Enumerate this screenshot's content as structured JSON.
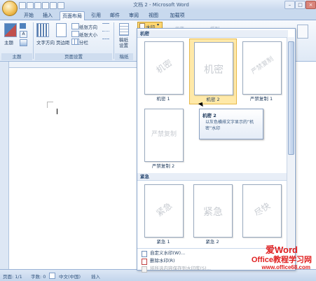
{
  "window": {
    "title": "文档 2 - Microsoft Word",
    "controls": {
      "minimize": "–",
      "maximize": "□",
      "close": "×"
    }
  },
  "tabs": [
    {
      "label": "开始"
    },
    {
      "label": "插入"
    },
    {
      "label": "页面布局",
      "active": true
    },
    {
      "label": "引用"
    },
    {
      "label": "邮件"
    },
    {
      "label": "审阅"
    },
    {
      "label": "视图"
    },
    {
      "label": "加载项"
    }
  ],
  "ribbon": {
    "themes_group": {
      "theme_button": "主题",
      "label": "主题"
    },
    "page_setup": {
      "text_direction": "文字方向",
      "margins": "页边距",
      "orientation": "纸张方向",
      "size": "纸张大小",
      "columns": "分栏",
      "label": "页面设置"
    },
    "paper_group": {
      "button": "稿纸设置",
      "label": "稿纸"
    },
    "watermark_button": "水印"
  },
  "watermark_menu": {
    "section_confidential": "机密",
    "section_urgent": "紧急",
    "thumbnails_confidential": [
      {
        "label": "机密 1",
        "text": "机密"
      },
      {
        "label": "机密 2",
        "text": "机密"
      },
      {
        "label": "严禁复制 1",
        "text": "严禁复制"
      },
      {
        "label": "严禁复制 2",
        "text": "严禁复制"
      }
    ],
    "thumbnails_urgent": [
      {
        "label": "紧急 1",
        "text": "紧急"
      },
      {
        "label": "紧急 2",
        "text": "紧急"
      },
      {
        "label": "",
        "text": "尽快"
      }
    ],
    "tooltip": {
      "title": "机密 2",
      "body": "以灰色横排文字显示的“机密”水印"
    },
    "menu_items": [
      {
        "label": "自定义水印(W)...",
        "enabled": true
      },
      {
        "label": "删除水印(R)",
        "enabled": true
      },
      {
        "label": "将所选内容保存到水印库(S)...",
        "enabled": false
      }
    ]
  },
  "status_bar": {
    "page": "页面: 1/1",
    "words": "字数: 0",
    "language": "中文(中国)",
    "mode": "插入"
  },
  "site_watermark": {
    "line1": "爱Word",
    "line2": "Office教程学习网",
    "url": "www.office68.com"
  },
  "colors": {
    "ribbon_bg": "#dfe9f6",
    "hover_highlight": "#ffe9a8",
    "logo_red": "#e02020",
    "logo_blue": "#1e5fb8"
  }
}
